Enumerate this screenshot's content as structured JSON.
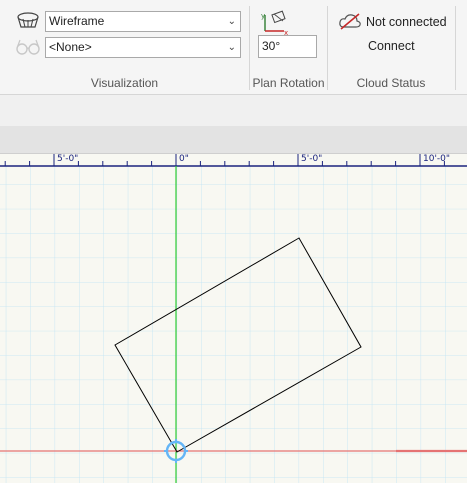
{
  "visualization": {
    "style_value": "Wireframe",
    "style2_value": "<None>",
    "label": "Visualization",
    "icon_style": "render-style-icon",
    "icon_glasses": "glasses-icon"
  },
  "plan_rotation": {
    "value": "30°",
    "label": "Plan Rotation",
    "icon": "axis-rotation-icon"
  },
  "cloud_status": {
    "status_text": "Not connected",
    "connect_label": "Connect",
    "label": "Cloud Status",
    "icon": "cloud-disconnected-icon"
  },
  "ruler": {
    "labels": [
      "5'-0\"",
      "0\"",
      "5'-0\"",
      "10'-0\""
    ]
  },
  "colors": {
    "grid": "#a8d8f0",
    "ruler": "#1a237e",
    "y_axis": "#33cc33",
    "x_axis": "#e57373",
    "origin": "#64b5f6"
  }
}
